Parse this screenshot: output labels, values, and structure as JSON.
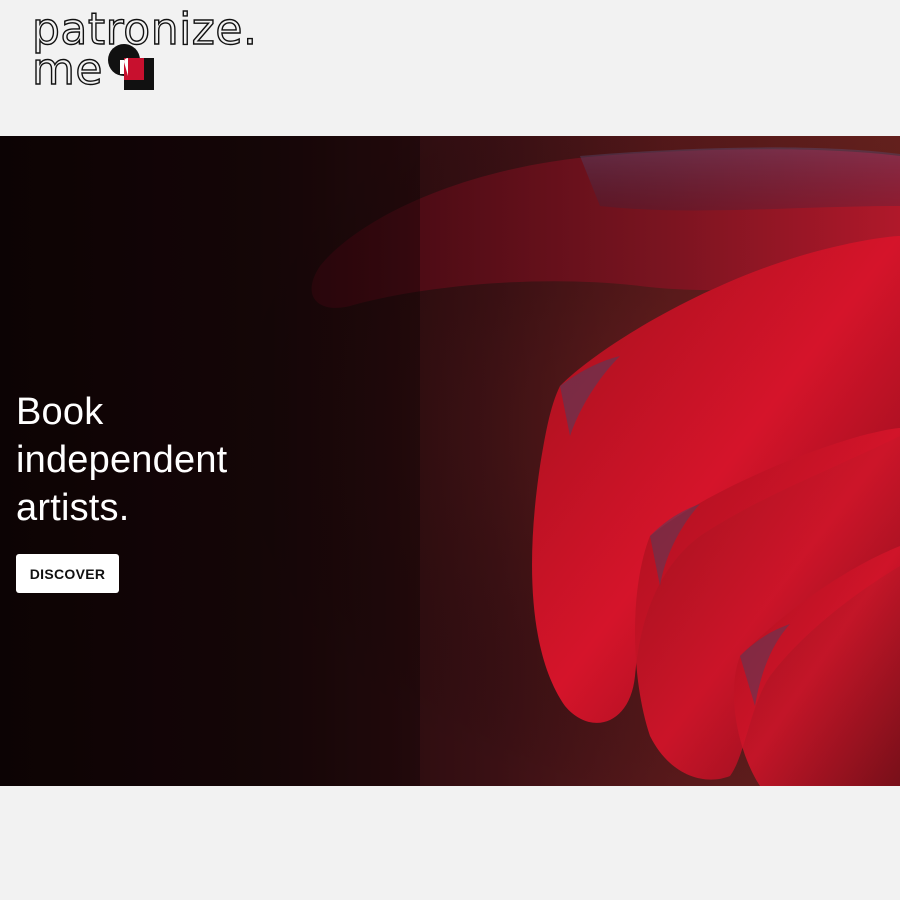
{
  "header": {
    "logo": {
      "line1": "patronize.",
      "line2": "me",
      "mark_colors": {
        "circle": "#111111",
        "accent": "#c8102e",
        "square": "#111111"
      }
    }
  },
  "hero": {
    "title_lines": [
      "Book",
      "independent",
      "artists."
    ],
    "cta_label": "DISCOVER",
    "background_colors": [
      "#0f0405",
      "#3a1014",
      "#6e2420"
    ],
    "image": "hand-illuminated-in-red-light"
  },
  "colors": {
    "page_background": "#f2f2f2",
    "hero_text": "#ffffff",
    "button_background": "#ffffff",
    "button_text": "#111111"
  }
}
